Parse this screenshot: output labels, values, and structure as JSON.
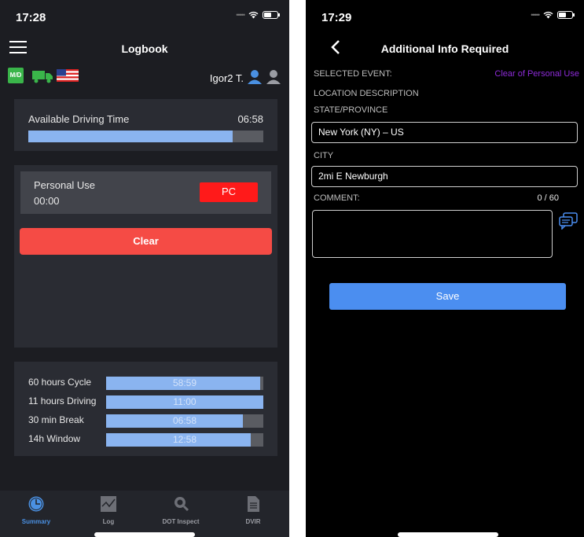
{
  "left": {
    "status": {
      "time": "17:28"
    },
    "header": {
      "title": "Logbook"
    },
    "toolbar": {
      "user_name": "Igor2 T."
    },
    "available_driving": {
      "label": "Available Driving Time",
      "value": "06:58",
      "progress": 0.87
    },
    "personal_use": {
      "label": "Personal Use",
      "time": "00:00",
      "button": "PC"
    },
    "clear_button": "Clear",
    "hours": [
      {
        "label": "60 hours Cycle",
        "value": "58:59",
        "progress": 0.98
      },
      {
        "label": "11 hours Driving",
        "value": "11:00",
        "progress": 1.0
      },
      {
        "label": "30 min Break",
        "value": "06:58",
        "progress": 0.87
      },
      {
        "label": "14h Window",
        "value": "12:58",
        "progress": 0.92
      }
    ],
    "tabs": [
      {
        "label": "Summary",
        "icon": "clock-icon",
        "active": true
      },
      {
        "label": "Log",
        "icon": "graph-icon",
        "active": false
      },
      {
        "label": "DOT Inspect",
        "icon": "magnifier-icon",
        "active": false
      },
      {
        "label": "DVIR",
        "icon": "document-icon",
        "active": false
      }
    ]
  },
  "right": {
    "status": {
      "time": "17:29"
    },
    "header": {
      "title": "Additional Info Required"
    },
    "selected_event": {
      "label": "SELECTED EVENT:",
      "value": "Clear of Personal Use"
    },
    "location_label": "LOCATION DESCRIPTION",
    "state": {
      "label": "STATE/PROVINCE",
      "value": "New York (NY) – US"
    },
    "city": {
      "label": "CITY",
      "value": "2mi E Newburgh"
    },
    "comment": {
      "label": "COMMENT:",
      "count": "0 / 60",
      "value": ""
    },
    "save_button": "Save"
  },
  "colors": {
    "bar_fill": "#8ab4f0",
    "pc_red": "#ff1a1a",
    "clear_red": "#f54b45",
    "save_blue": "#4b8ef0",
    "accent_purple": "#8e2bd9",
    "active_tab": "#4a90e2"
  }
}
